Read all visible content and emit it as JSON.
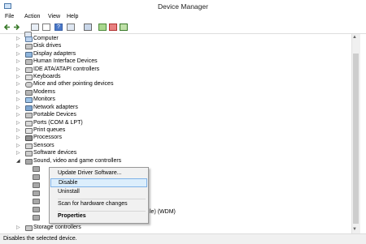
{
  "window": {
    "title": "Device Manager"
  },
  "menu": [
    "File",
    "Action",
    "View",
    "Help"
  ],
  "colors": {
    "selection_bg": "#dceefc",
    "selection_border": "#7fb2e8",
    "status_bg": "#f0f0f0"
  },
  "toolbar": {
    "icons": [
      "back-arrow-icon",
      "forward-arrow-icon",
      "view-icon",
      "properties-icon",
      "help-icon",
      "device-list-icon",
      "update-driver-icon",
      "uninstall-icon",
      "disable-icon",
      "scan-hardware-icon"
    ]
  },
  "tree": {
    "items": [
      {
        "label": "Computer",
        "icon": "computer-icon"
      },
      {
        "label": "Disk drives",
        "icon": "disk-drive-icon"
      },
      {
        "label": "Display adapters",
        "icon": "display-adapter-icon"
      },
      {
        "label": "Human Interface Devices",
        "icon": "hid-icon"
      },
      {
        "label": "IDE ATA/ATAPI controllers",
        "icon": "ide-controller-icon"
      },
      {
        "label": "Keyboards",
        "icon": "keyboard-icon"
      },
      {
        "label": "Mice and other pointing devices",
        "icon": "mouse-icon"
      },
      {
        "label": "Modems",
        "icon": "modem-icon"
      },
      {
        "label": "Monitors",
        "icon": "monitor-icon"
      },
      {
        "label": "Network adapters",
        "icon": "network-adapter-icon"
      },
      {
        "label": "Portable Devices",
        "icon": "portable-device-icon"
      },
      {
        "label": "Ports (COM & LPT)",
        "icon": "port-icon"
      },
      {
        "label": "Print queues",
        "icon": "printer-icon"
      },
      {
        "label": "Processors",
        "icon": "processor-icon"
      },
      {
        "label": "Sensors",
        "icon": "sensor-icon"
      },
      {
        "label": "Software devices",
        "icon": "software-device-icon"
      },
      {
        "label": "Sound, video and game controllers",
        "icon": "speaker-icon",
        "expanded": true
      }
    ],
    "partial_labels": {
      "storage": "Storage controllers",
      "wdm": "le) (WDM)"
    }
  },
  "context_menu": {
    "items": [
      "Update Driver Software...",
      "Disable",
      "Uninstall",
      "Scan for hardware changes",
      "Properties"
    ],
    "highlighted": "Disable"
  },
  "status": "Disables the selected device."
}
